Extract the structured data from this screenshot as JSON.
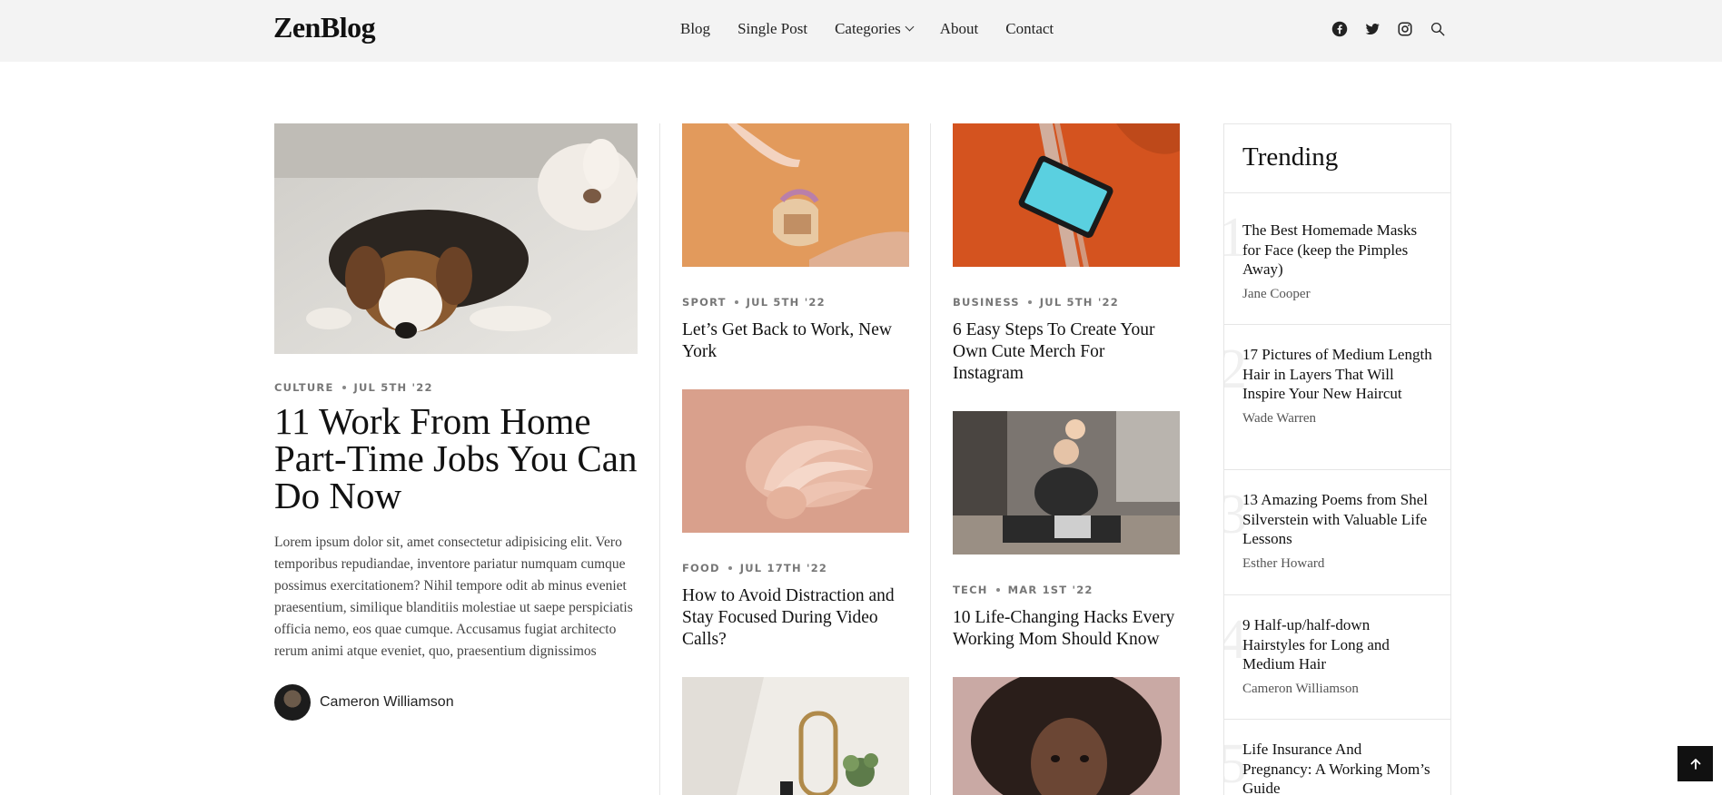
{
  "header": {
    "logo": "ZenBlog",
    "nav": [
      {
        "label": "Blog"
      },
      {
        "label": "Single Post"
      },
      {
        "label": "Categories"
      },
      {
        "label": "About"
      },
      {
        "label": "Contact"
      }
    ],
    "social_icons": [
      "facebook-icon",
      "twitter-icon",
      "instagram-icon",
      "search-icon"
    ]
  },
  "featured": {
    "category": "Culture",
    "date": "Jul 5th '22",
    "title": "11 Work From Home Part-Time Jobs You Can Do Now",
    "excerpt": "Lorem ipsum dolor sit, amet consectetur adipisicing elit. Vero temporibus repudiandae, inventore pariatur numquam cumque possimus exercitationem? Nihil tempore odit ab minus eveniet praesentium, similique blanditiis molestiae ut saepe perspiciatis officia nemo, eos quae cumque. Accusamus fugiat architecto rerum animi atque eveniet, quo, praesentium dignissimos",
    "author": "Cameron Williamson"
  },
  "posts_col1": [
    {
      "category": "Sport",
      "date": "Jul 5th '22",
      "title": "Let’s Get Back to Work, New York"
    },
    {
      "category": "Food",
      "date": "Jul 17th '22",
      "title": "How to Avoid Distraction and Stay Focused During Video Calls?"
    }
  ],
  "posts_col2": [
    {
      "category": "Business",
      "date": "Jul 5th '22",
      "title": "6 Easy Steps To Create Your Own Cute Merch For Instagram"
    },
    {
      "category": "Tech",
      "date": "Mar 1st '22",
      "title": "10 Life-Changing Hacks Every Working Mom Should Know"
    }
  ],
  "trending": {
    "heading": "Trending",
    "items": [
      {
        "num": "1",
        "title": "The Best Homemade Masks for Face (keep the Pimples Away)",
        "author": "Jane Cooper"
      },
      {
        "num": "2",
        "title": "17 Pictures of Medium Length Hair in Layers That Will Inspire Your New Haircut",
        "author": "Wade Warren"
      },
      {
        "num": "3",
        "title": "13 Amazing Poems from Shel Silverstein with Valuable Life Lessons",
        "author": "Esther Howard"
      },
      {
        "num": "4",
        "title": "9 Half-up/half-down Hairstyles for Long and Medium Hair",
        "author": "Cameron Williamson"
      },
      {
        "num": "5",
        "title": "Life Insurance And Pregnancy: A Working Mom’s Guide",
        "author": ""
      }
    ]
  },
  "colors": {
    "header_bg": "#f3f3f3",
    "divider": "#e6e6e6",
    "meta": "#777777"
  }
}
